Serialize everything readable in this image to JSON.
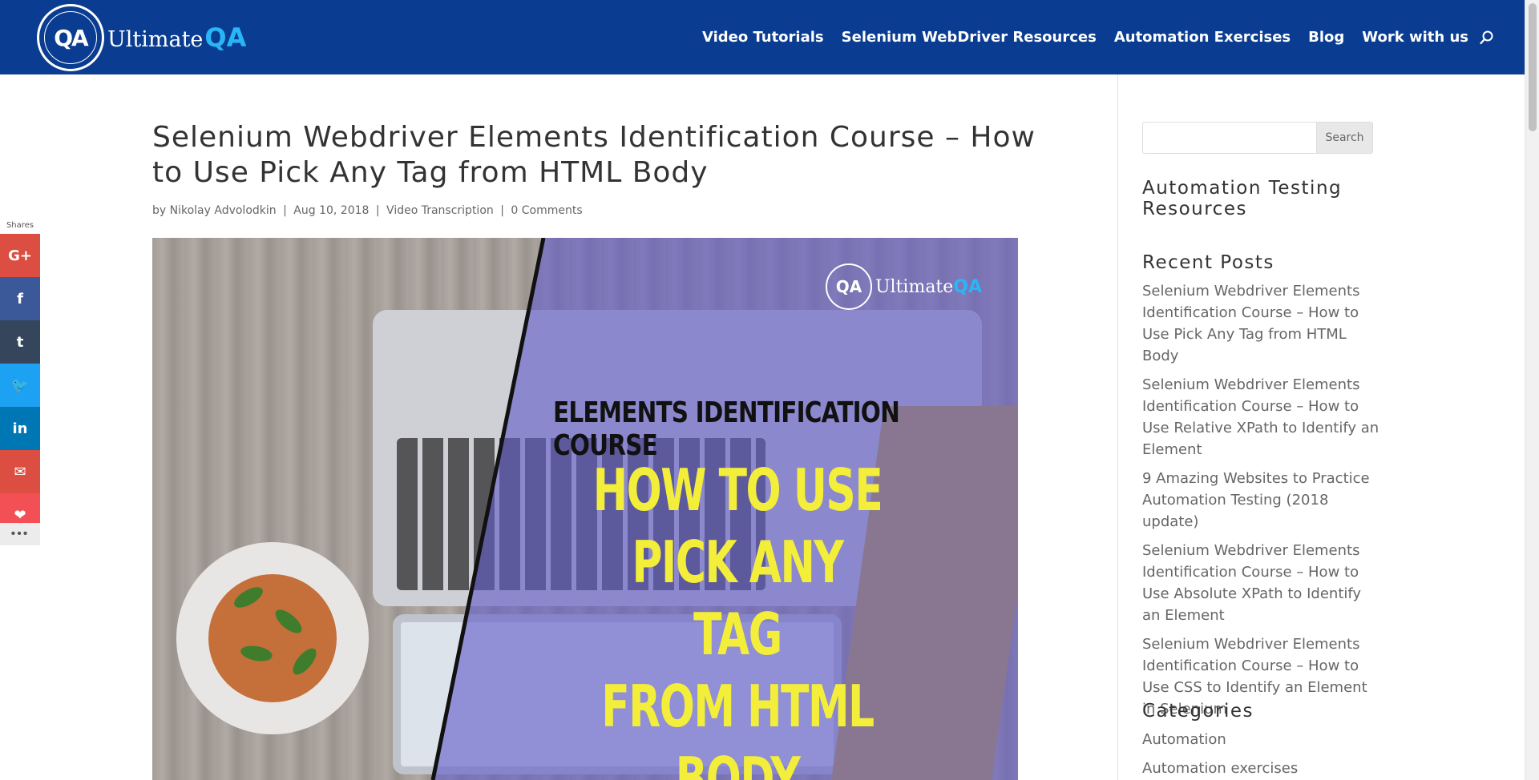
{
  "header": {
    "logo_brand": "Ultimate",
    "logo_qa": "QA",
    "nav": [
      {
        "label": "Video Tutorials"
      },
      {
        "label": "Selenium WebDriver Resources"
      },
      {
        "label": "Automation Exercises"
      },
      {
        "label": "Blog"
      },
      {
        "label": "Work with us"
      }
    ],
    "search_icon": "search-icon"
  },
  "article": {
    "title": "Selenium Webdriver Elements Identification Course – How to Use Pick Any Tag from HTML Body",
    "meta": {
      "by": "by",
      "author": "Nikolay Advolodkin",
      "date": "Aug 10, 2018",
      "category": "Video Transcription",
      "comments": "0 Comments",
      "separator": "|"
    },
    "featured_image": {
      "logo_brand": "Ultimate",
      "logo_qa": "QA",
      "subtitle": "ELEMENTS IDENTIFICATION COURSE",
      "headline_line1": "HOW TO USE PICK ANY TAG",
      "headline_line2": "FROM HTML BODY"
    }
  },
  "share": {
    "label": "Shares",
    "buttons": [
      {
        "name": "google-plus",
        "glyph": "G+",
        "color": "#dc4e41"
      },
      {
        "name": "facebook",
        "glyph": "f",
        "color": "#3b5998"
      },
      {
        "name": "tumblr",
        "glyph": "t",
        "color": "#35465c"
      },
      {
        "name": "twitter",
        "glyph": "🐦",
        "color": "#1da1f2"
      },
      {
        "name": "linkedin",
        "glyph": "in",
        "color": "#0077b5"
      },
      {
        "name": "email",
        "glyph": "✉",
        "color": "#dc4e41"
      },
      {
        "name": "favorite",
        "glyph": "❤",
        "color": "#f25055"
      }
    ],
    "more": "•••"
  },
  "sidebar": {
    "search_button": "Search",
    "resources_title": "Automation Testing Resources",
    "recent_title": "Recent Posts",
    "recent_posts": [
      "Selenium Webdriver Elements Identification Course – How to Use Pick Any Tag from HTML Body",
      "Selenium Webdriver Elements Identification Course – How to Use Relative XPath to Identify an Element",
      "9 Amazing Websites to Practice Automation Testing (2018 update)",
      "Selenium Webdriver Elements Identification Course – How to Use Absolute XPath to Identify an Element",
      "Selenium Webdriver Elements Identification Course – How to Use CSS to Identify an Element in Selenium"
    ],
    "categories_title": "Categories",
    "categories": [
      "Automation",
      "Automation exercises"
    ]
  },
  "colors": {
    "header_bg": "#0a3d91",
    "accent": "#29b6f6",
    "headline_yellow": "#f3ee3a"
  }
}
